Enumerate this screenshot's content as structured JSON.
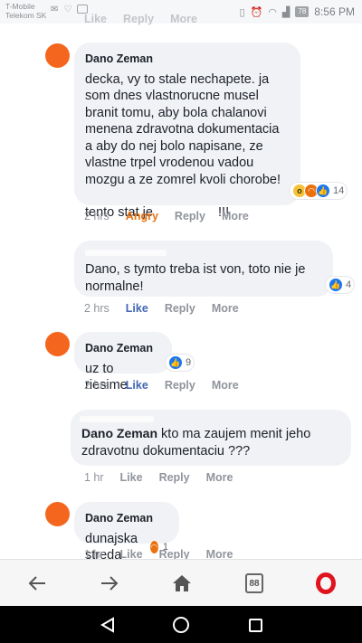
{
  "status_bar": {
    "carrier_line1": "T-Mobile",
    "carrier_line2": "Telekom SK",
    "battery": "78",
    "time": "8:56 PM"
  },
  "top_partial": {
    "like": "Like",
    "reply": "Reply",
    "more": "More"
  },
  "comments": [
    {
      "author": "Dano Zeman",
      "text": "decka, vy to stale nechapete. ja som dnes vlastnorucne musel branit tomu, aby bola chalanovi menena zdravotna dokumentacia a aby do nej bolo napisane, ze vlastne trpel vrodenou vadou mozgu a ze zomrel kvoli chorobe!",
      "text2_prefix": "tento stat je",
      "text2_suffix": "!!!",
      "reaction_count": "14",
      "time": "2 hrs",
      "reaction_label": "Angry",
      "reply": "Reply",
      "more": "More"
    },
    {
      "author": "",
      "text": "Dano, s tymto treba ist von, toto nie je normalne!",
      "reaction_count": "4",
      "time": "2 hrs",
      "reaction_label": "Like",
      "reply": "Reply",
      "more": "More"
    },
    {
      "author": "Dano Zeman",
      "text": "uz to riesime.",
      "reaction_count": "9",
      "time": "2 hrs",
      "reaction_label": "Like",
      "reply": "Reply",
      "more": "More"
    },
    {
      "author": "Dano Zeman",
      "text": "kto ma zaujem menit jeho zdravotnu dokumentaciu ???",
      "time": "1 hr",
      "reaction_label": "Like",
      "reply": "Reply",
      "more": "More"
    },
    {
      "author": "Dano Zeman",
      "text": "dunajska streda",
      "reaction_count": "1",
      "time": "1 hr",
      "reaction_label": "Like",
      "reply": "Reply",
      "more": "More"
    }
  ],
  "browser": {
    "tabs_count": "88"
  },
  "colors": {
    "avatar": "#f4661e",
    "bubble": "#f0f2f5",
    "angry": "#e9710f",
    "like": "#4267b2",
    "opera": "#e0131e"
  }
}
